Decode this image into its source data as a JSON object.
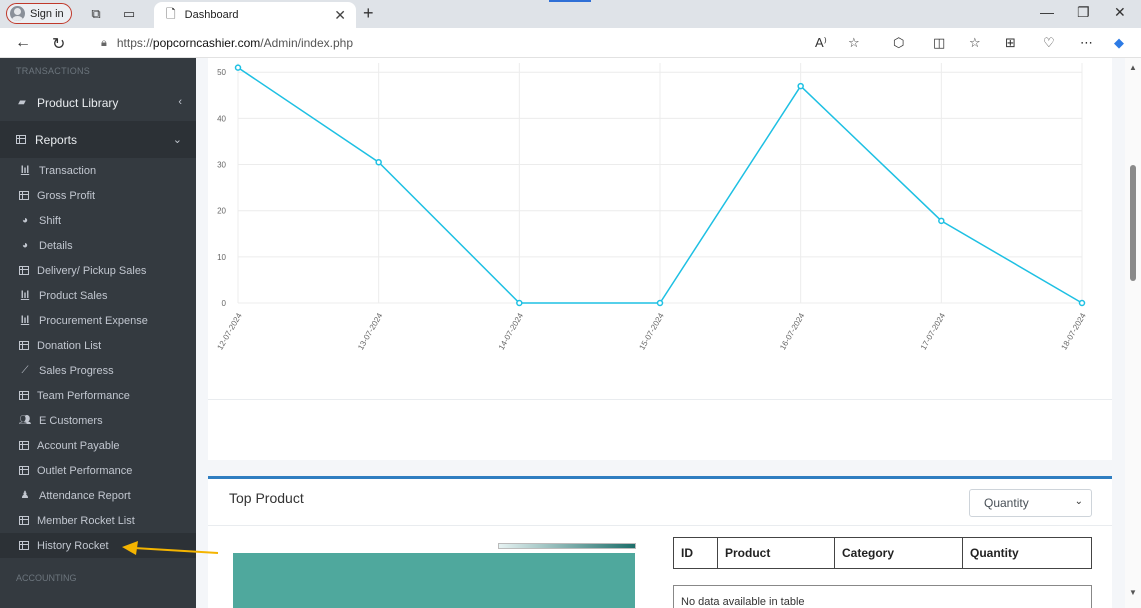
{
  "browser": {
    "signin_label": "Sign in",
    "tab_title": "Dashboard",
    "url_prefix": "https://",
    "url_domain": "popcorncashier.com",
    "url_path": "/Admin/index.php"
  },
  "sidebar": {
    "section_top": "TRANSACTIONS",
    "product_library": "Product Library",
    "reports": "Reports",
    "items": [
      {
        "label": "Transaction",
        "icon": "bar-chart-icon"
      },
      {
        "label": "Gross Profit",
        "icon": "table-icon"
      },
      {
        "label": "Shift",
        "icon": "pie-chart-icon"
      },
      {
        "label": "Details",
        "icon": "pie-chart-icon"
      },
      {
        "label": "Delivery/ Pickup Sales",
        "icon": "table-icon"
      },
      {
        "label": "Product Sales",
        "icon": "bar-chart-icon"
      },
      {
        "label": "Procurement Expense",
        "icon": "bar-chart-icon"
      },
      {
        "label": "Donation List",
        "icon": "table-icon"
      },
      {
        "label": "Sales Progress",
        "icon": "line-chart-icon"
      },
      {
        "label": "Team Performance",
        "icon": "table-icon"
      },
      {
        "label": "E Customers",
        "icon": "users-icon"
      },
      {
        "label": "Account Payable",
        "icon": "table-icon"
      },
      {
        "label": "Outlet Performance",
        "icon": "table-icon"
      },
      {
        "label": "Attendance Report",
        "icon": "person-icon"
      },
      {
        "label": "Member Rocket List",
        "icon": "table-icon"
      },
      {
        "label": "History Rocket",
        "icon": "table-icon"
      }
    ],
    "section_bottom": "ACCOUNTING"
  },
  "chart_data": {
    "type": "line",
    "x": [
      "12-07-2024",
      "13-07-2024",
      "14-07-2024",
      "15-07-2024",
      "16-07-2024",
      "17-07-2024",
      "18-07-2024"
    ],
    "series": [
      {
        "values": [
          51,
          30.5,
          0,
          0,
          47,
          17.8,
          0
        ]
      }
    ],
    "ylim": [
      0,
      52
    ],
    "yticks": [
      0,
      10,
      20,
      30,
      40,
      50
    ],
    "grid": true,
    "color": "#1ec0e3"
  },
  "top_product": {
    "title": "Top Product",
    "select_value": "Quantity",
    "columns": [
      "ID",
      "Product",
      "Category",
      "Quantity"
    ],
    "empty_text": "No data available in table"
  },
  "colors": {
    "sidebar_bg": "#343a40",
    "accent": "#2f7ec1",
    "arrow": "#f4b400"
  }
}
